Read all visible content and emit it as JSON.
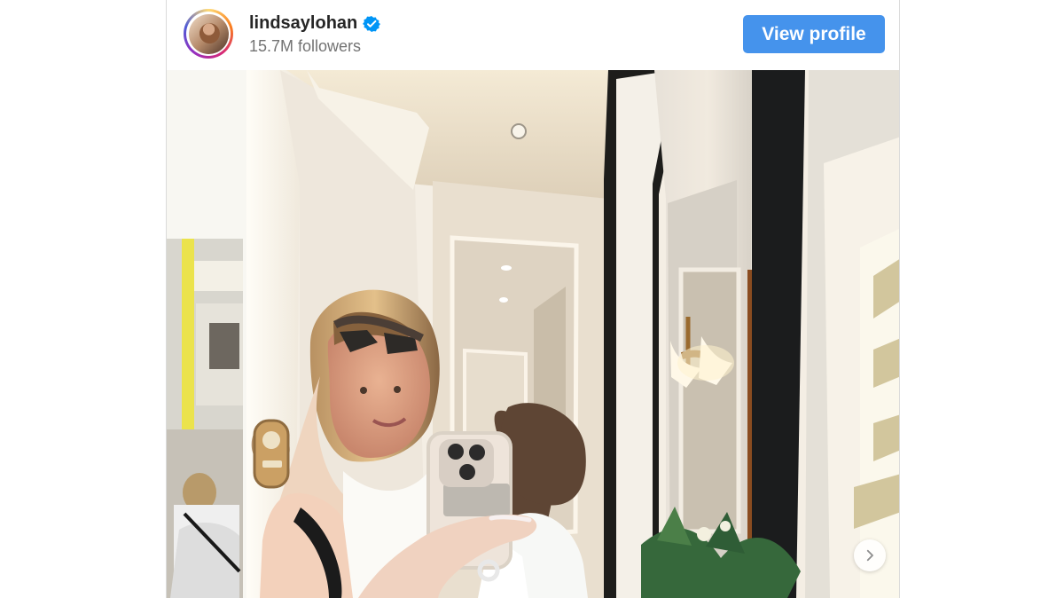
{
  "profile": {
    "username": "lindsaylohan",
    "followers": "15.7M followers",
    "verified": true,
    "avatar_icon": "profile-photo-icon"
  },
  "actions": {
    "view_profile_label": "View profile",
    "next_icon": "chevron-right-icon"
  },
  "colors": {
    "button_blue": "#4593ec",
    "verified_blue": "#0095f6",
    "text_primary": "#262626",
    "text_secondary": "#737373"
  }
}
